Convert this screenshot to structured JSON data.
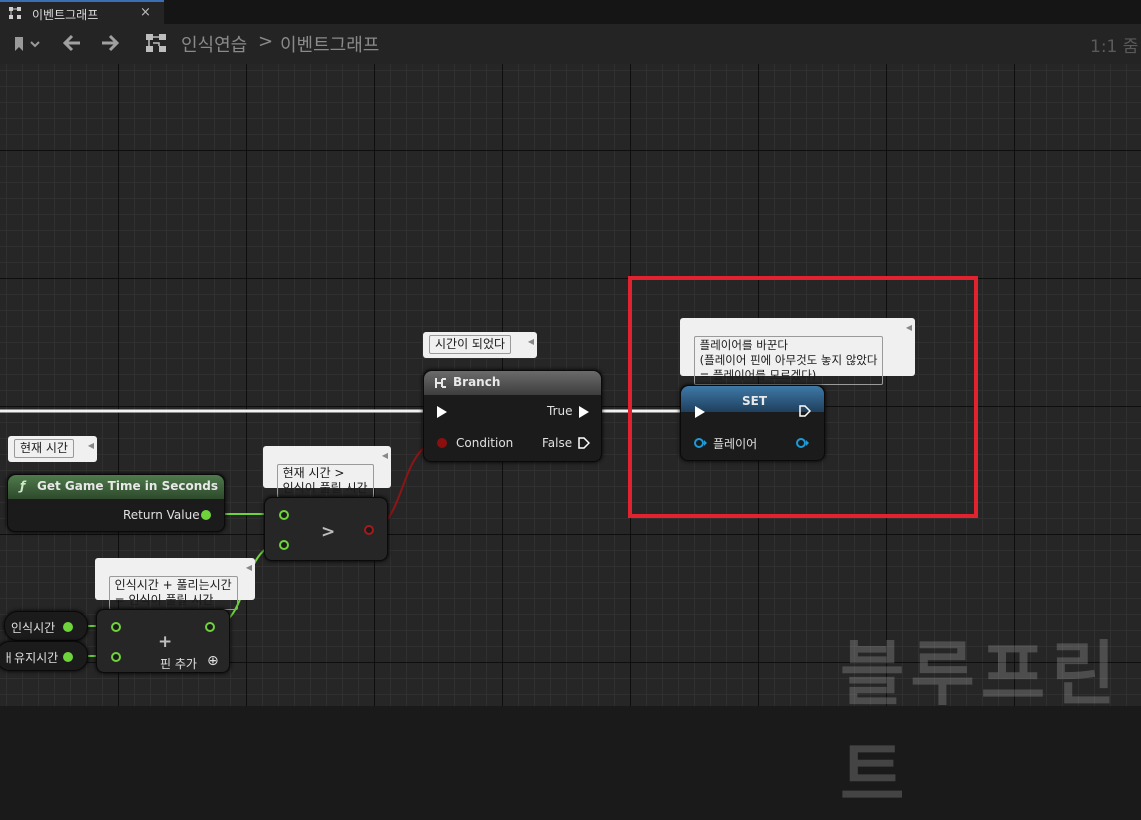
{
  "tab": {
    "title": "이벤트그래프",
    "close": "×"
  },
  "toolbar": {
    "breadcrumb_root": "인식연습",
    "breadcrumb_sep": ">",
    "breadcrumb_current": "이벤트그래프",
    "zoom": "1:1 줌"
  },
  "comments": {
    "time_up": "시간이 되었다",
    "current_time": "현재 시간",
    "compare": "현재 시간 >\n인식이 풀릴 시간",
    "add": "인식시간 + 풀리는시간\n= 인식이 풀릴 시간",
    "set": "플레이어를 바꾼다\n(플레이어 핀에 아무것도 놓지 않았다\n= 플레이어를 모르겠다)"
  },
  "nodes": {
    "branch": {
      "title": "Branch",
      "condition": "Condition",
      "true_label": "True",
      "false_label": "False"
    },
    "game_time": {
      "title": "Get Game Time in Seconds",
      "return_value": "Return Value"
    },
    "compare": {
      "op": ">"
    },
    "add": {
      "op": "+",
      "add_pin": "핀 추가"
    },
    "set": {
      "title": "SET",
      "player": "플레이어"
    },
    "var1": {
      "label": "인식시간"
    },
    "var2": {
      "label": "ㅐ유지시간"
    }
  },
  "watermark": "블루프린트",
  "colors": {
    "exec": "#ffffff",
    "float": "#6fd33b",
    "bool": "#8c0f0f",
    "object": "#1e9ad6",
    "highlight": "#e0232e",
    "set_header": "#2f5d84",
    "func_header": "#2f4e2f"
  }
}
